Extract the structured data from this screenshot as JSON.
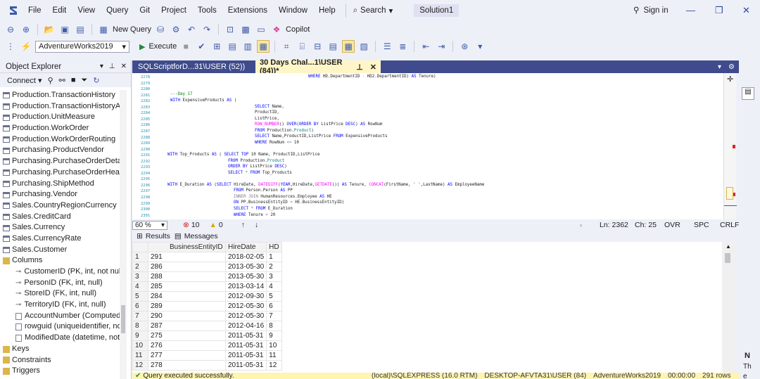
{
  "menu": [
    "File",
    "Edit",
    "View",
    "Query",
    "Git",
    "Project",
    "Tools",
    "Extensions",
    "Window",
    "Help"
  ],
  "search_label": "Search",
  "solution": "Solution1",
  "signin": "Sign in",
  "toolbar": {
    "new_query": "New Query",
    "copilot": "Copilot",
    "database": "AdventureWorks2019",
    "execute": "Execute"
  },
  "object_explorer": {
    "title": "Object Explorer",
    "connect": "Connect",
    "tables": [
      "Production.TransactionHistory",
      "Production.TransactionHistoryArch",
      "Production.UnitMeasure",
      "Production.WorkOrder",
      "Production.WorkOrderRouting",
      "Purchasing.ProductVendor",
      "Purchasing.PurchaseOrderDetail",
      "Purchasing.PurchaseOrderHeader",
      "Purchasing.ShipMethod",
      "Purchasing.Vendor",
      "Sales.CountryRegionCurrency",
      "Sales.CreditCard",
      "Sales.Currency",
      "Sales.CurrencyRate",
      "Sales.Customer"
    ],
    "columns_folder": "Columns",
    "columns": [
      "CustomerID (PK, int, not null)",
      "PersonID (FK, int, null)",
      "StoreID (FK, int, null)",
      "TerritoryID (FK, int, null)",
      "AccountNumber (Computed,",
      "rowguid (uniqueidentifier, no",
      "ModifiedDate (datetime, not"
    ],
    "folders": [
      "Keys",
      "Constraints",
      "Triggers"
    ]
  },
  "tabs": {
    "tab1": "SQLScriptforD...31\\USER (52))",
    "tab2": "30 Days Chal...1\\USER (84))*"
  },
  "editor": {
    "line_numbers": [
      "2278",
      "2279",
      "2280",
      "2281",
      "2282",
      "2283",
      "2284",
      "2285",
      "2286",
      "2287",
      "2288",
      "2289",
      "2290",
      "2291",
      "2292",
      "2293",
      "2294",
      "2295",
      "2296",
      "2297",
      "2298",
      "2299",
      "2300",
      "2301"
    ]
  },
  "status": {
    "zoom": "60 %",
    "errors": "10",
    "warnings": "0",
    "line": "Ln: 2362",
    "col": "Ch: 25",
    "ovr": "OVR",
    "spc": "SPC",
    "crlf": "CRLF"
  },
  "results": {
    "tab_results": "Results",
    "tab_messages": "Messages",
    "columns": [
      "BusinessEntityID",
      "HireDate",
      "HD"
    ],
    "rows": [
      [
        "291",
        "2018-02-05",
        "1"
      ],
      [
        "286",
        "2013-05-30",
        "2"
      ],
      [
        "288",
        "2013-05-30",
        "3"
      ],
      [
        "285",
        "2013-03-14",
        "4"
      ],
      [
        "284",
        "2012-09-30",
        "5"
      ],
      [
        "289",
        "2012-05-30",
        "6"
      ],
      [
        "290",
        "2012-05-30",
        "7"
      ],
      [
        "287",
        "2012-04-16",
        "8"
      ],
      [
        "275",
        "2011-05-31",
        "9"
      ],
      [
        "276",
        "2011-05-31",
        "10"
      ],
      [
        "277",
        "2011-05-31",
        "11"
      ],
      [
        "278",
        "2011-05-31",
        "12"
      ]
    ]
  },
  "query_status": {
    "message": "Query executed successfully.",
    "server": "(local)\\SQLEXPRESS (16.0 RTM)",
    "user": "DESKTOP-AFVTA31\\USER (84)",
    "db": "AdventureWorks2019",
    "time": "00:00:00",
    "rows": "291 rows"
  },
  "right_panel": {
    "n": "N",
    "th": "Th",
    "e": "e"
  }
}
